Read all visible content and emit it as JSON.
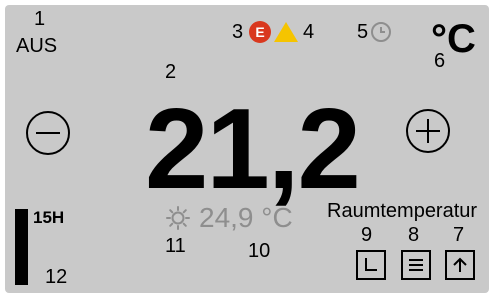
{
  "callouts": {
    "c1": "1",
    "c2": "2",
    "c3": "3",
    "c4": "4",
    "c5": "5",
    "c6": "6",
    "c7": "7",
    "c8": "8",
    "c9": "9",
    "c10": "10",
    "c11": "11",
    "c12": "12"
  },
  "status": {
    "mode": "AUS",
    "error_letter": "E",
    "unit": "°C"
  },
  "setpoint": {
    "value": "21,2"
  },
  "room": {
    "temperature": "24,9 °C",
    "label": "Raumtemperatur"
  },
  "timer": {
    "hours": "15H"
  },
  "icons": {
    "error": "error-e-icon",
    "warning": "warning-triangle-icon",
    "schedule": "clock-icon",
    "sun": "sun-icon",
    "decrease": "minus-icon",
    "increase": "plus-icon",
    "program": "program-l-icon",
    "menu": "menu-lines-icon",
    "up": "arrow-up-icon"
  },
  "colors": {
    "background": "#c9c9c9",
    "error": "#d9381e",
    "warning": "#f5c400",
    "muted": "#8e8e8e"
  }
}
